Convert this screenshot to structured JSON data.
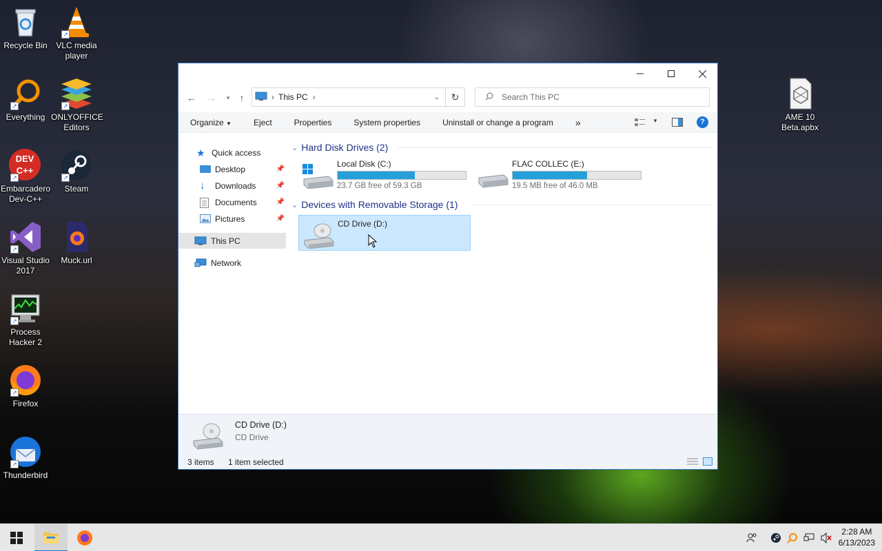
{
  "desktop": {
    "icons": [
      {
        "label": "Recycle Bin"
      },
      {
        "label": "VLC media player"
      },
      {
        "label": "Everything"
      },
      {
        "label": "ONLYOFFICE Editors"
      },
      {
        "label": "Embarcadero Dev-C++"
      },
      {
        "label": "Steam"
      },
      {
        "label": "Visual Studio 2017"
      },
      {
        "label": "Muck.url"
      },
      {
        "label": "Process Hacker 2"
      },
      {
        "label": "Firefox"
      },
      {
        "label": "Thunderbird"
      },
      {
        "label": "AME 10 Beta.apbx"
      }
    ],
    "devcpp_badge": "DEV C++"
  },
  "window": {
    "address": {
      "location": "This PC",
      "sep1": "›",
      "sep2": "›"
    },
    "search_placeholder": "Search This PC",
    "toolbar": {
      "organize": "Organize",
      "eject": "Eject",
      "properties": "Properties",
      "system_properties": "System properties",
      "uninstall": "Uninstall or change a program",
      "more": "»"
    },
    "nav": {
      "quick_access": "Quick access",
      "desktop": "Desktop",
      "downloads": "Downloads",
      "documents": "Documents",
      "pictures": "Pictures",
      "this_pc": "This PC",
      "network": "Network"
    },
    "groups": {
      "hard_disk": "Hard Disk Drives (2)",
      "removable": "Devices with Removable Storage (1)"
    },
    "drives": [
      {
        "name": "Local Disk (C:)",
        "free": "23.7 GB free of 59.3 GB",
        "used_fraction": 0.6
      },
      {
        "name": "FLAC COLLEC (E:)",
        "free": "19.5 MB free of 46.0 MB",
        "used_fraction": 0.58
      },
      {
        "name": "CD Drive (D:)"
      }
    ],
    "details": {
      "name": "CD Drive (D:)",
      "type": "CD Drive"
    },
    "status": {
      "items": "3 items",
      "selected": "1 item selected"
    }
  },
  "taskbar": {
    "time": "2:28 AM",
    "date": "6/13/2023"
  },
  "colors": {
    "accent": "#26a0da",
    "selection": "#cce8ff",
    "selection_border": "#99d1ff",
    "group_header": "#1e3287"
  }
}
